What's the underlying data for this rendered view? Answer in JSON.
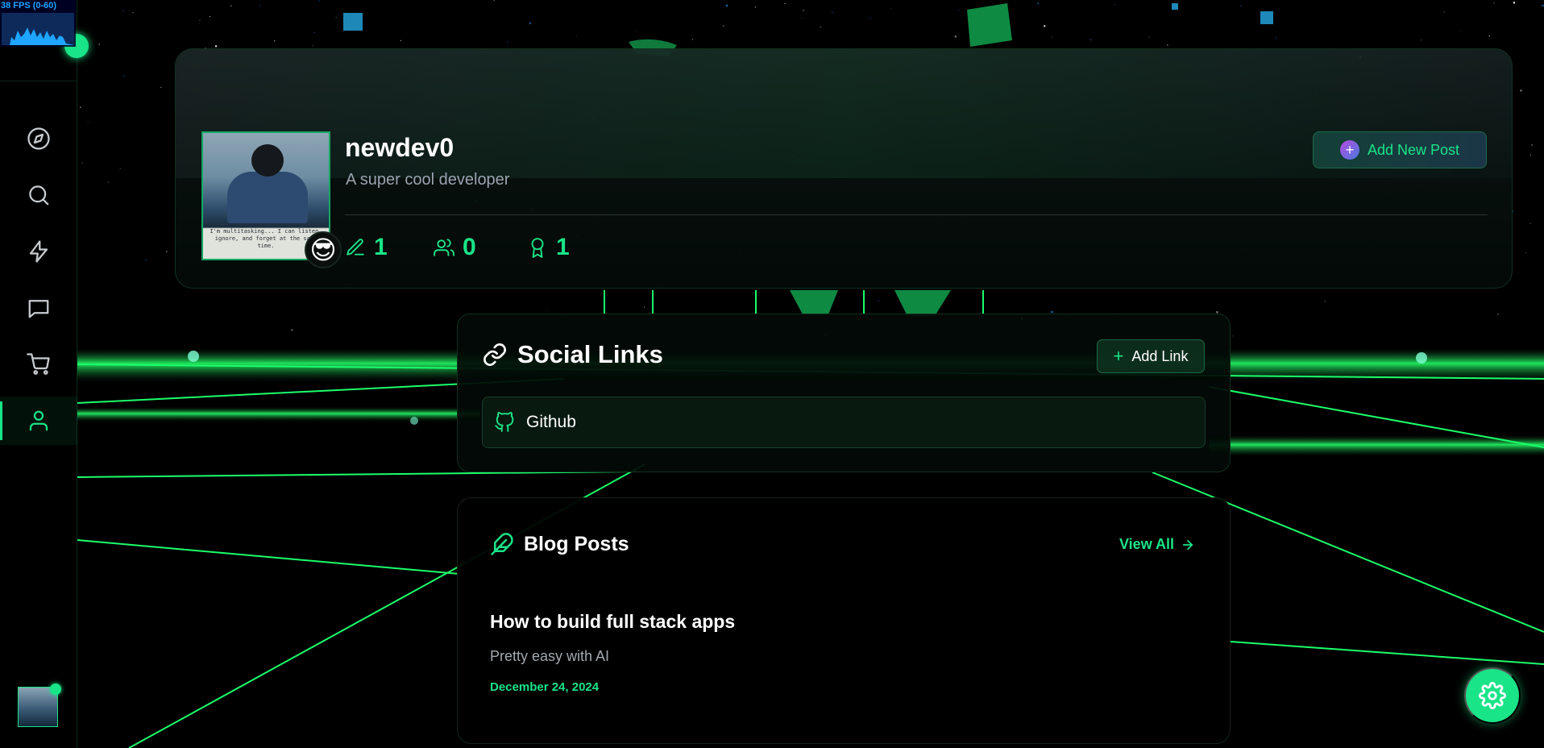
{
  "fps": {
    "label": "38 FPS (0-60)"
  },
  "sidebar": {
    "items": [
      {
        "icon": "compass-icon",
        "active": false
      },
      {
        "icon": "search-icon",
        "active": false
      },
      {
        "icon": "lightning-icon",
        "active": false
      },
      {
        "icon": "chat-icon",
        "active": false
      },
      {
        "icon": "cart-icon",
        "active": false
      },
      {
        "icon": "user-icon",
        "active": true
      }
    ]
  },
  "profile": {
    "username": "newdev0",
    "bio": "A super cool developer",
    "photo_quote": "I'm multitasking... I can listen, ignore, and forget at the same time.",
    "emoji": "😎",
    "stats": {
      "posts": "1",
      "followers": "0",
      "achievements": "1"
    },
    "add_post_label": "Add New Post"
  },
  "social": {
    "title": "Social Links",
    "add_link_label": "Add Link",
    "links": [
      {
        "label": "Github"
      }
    ]
  },
  "blog": {
    "title": "Blog Posts",
    "view_all_label": "View All",
    "posts": [
      {
        "title": "How to build full stack apps",
        "excerpt": "Pretty easy with AI",
        "date": "December 24, 2024"
      }
    ]
  },
  "colors": {
    "accent": "#19e487",
    "background": "#000000",
    "grid": "#1bff6b"
  }
}
